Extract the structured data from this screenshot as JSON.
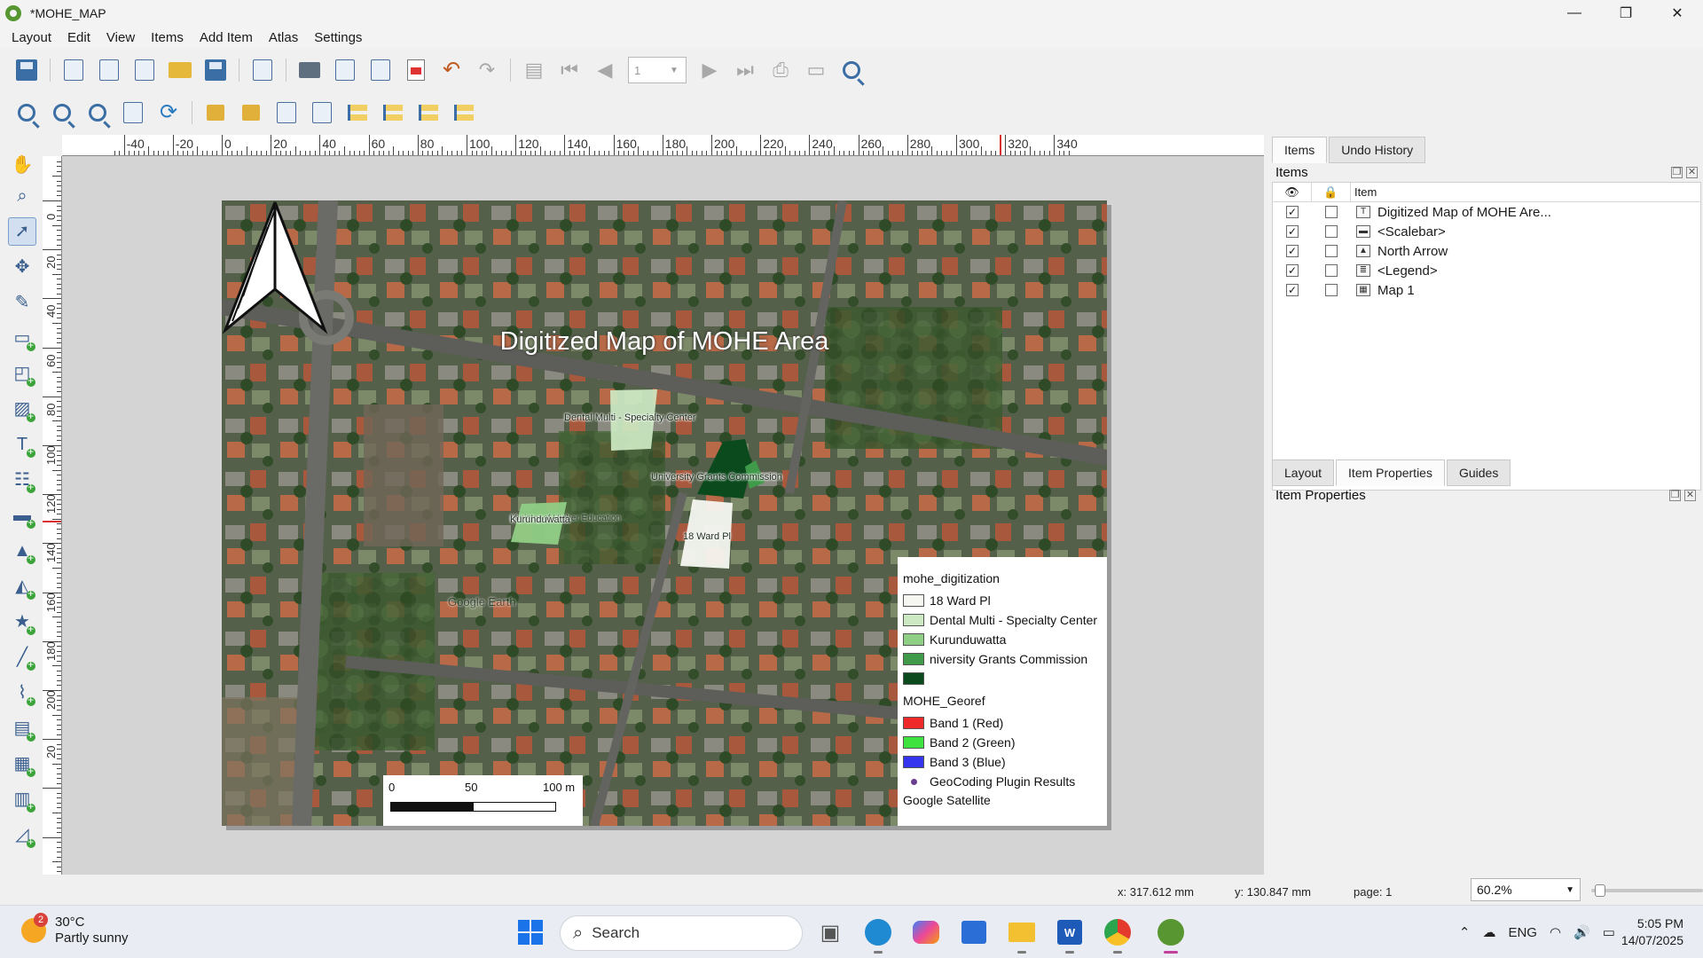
{
  "window": {
    "title": "*MOHE_MAP",
    "minimize": "—",
    "maximize": "❐",
    "close": "✕"
  },
  "menu": [
    "Layout",
    "Edit",
    "View",
    "Items",
    "Add Item",
    "Atlas",
    "Settings"
  ],
  "toolbar": {
    "page_value": "1"
  },
  "rulers": {
    "h_labels": [
      "-40",
      "-20",
      "0",
      "20",
      "40",
      "60",
      "80",
      "100",
      "120",
      "140",
      "160",
      "180",
      "200",
      "220",
      "240",
      "260",
      "280",
      "300",
      "320",
      "340"
    ],
    "v_labels": [
      "0",
      "20",
      "40",
      "60",
      "80",
      "100",
      "120",
      "140",
      "160",
      "180",
      "200",
      "20"
    ]
  },
  "layout": {
    "title": "Digitized Map of MOHE Area",
    "polygon_labels": {
      "dental": "Dental Multi - Specialty Center",
      "ugc": "University Grants Commission",
      "kurunduwatta": "Kurunduwatta",
      "ward": "18 Ward Pl",
      "ministry": "Ministry of Higher Education",
      "google": "Google Earth"
    },
    "scalebar": {
      "labels": [
        "0",
        "50",
        "100 m"
      ]
    },
    "legend": {
      "group1": "mohe_digitization",
      "group1_items": [
        {
          "label": "18 Ward Pl",
          "color": "#f6f7f1"
        },
        {
          "label": "Dental Multi - Specialty Center",
          "color": "#cde9c3"
        },
        {
          "label": "Kurunduwatta",
          "color": "#8fce85"
        },
        {
          "label": "niversity Grants Commission",
          "color": "#3f9a4a"
        },
        {
          "label": "",
          "color": "#0b4a1d"
        }
      ],
      "group2": "MOHE_Georef",
      "group2_items": [
        {
          "label": "Band 1 (Red)",
          "color": "#ef2929"
        },
        {
          "label": "Band 2 (Green)",
          "color": "#3fe33f"
        },
        {
          "label": "Band 3 (Blue)",
          "color": "#3535ef"
        }
      ],
      "geocoding": "GeoCoding Plugin Results",
      "basemap": "Google Satellite"
    }
  },
  "right_panel": {
    "top_tabs": [
      "Items",
      "Undo History"
    ],
    "items_title": "Items",
    "items_header": {
      "item": "Item"
    },
    "items": [
      {
        "label": "Digitized Map of MOHE Are...",
        "icon": "T",
        "visible": "✓"
      },
      {
        "label": "<Scalebar>",
        "icon": "▬",
        "visible": "✓"
      },
      {
        "label": "North Arrow",
        "icon": "▲",
        "visible": "✓"
      },
      {
        "label": "<Legend>",
        "icon": "≣",
        "visible": "✓"
      },
      {
        "label": "Map 1",
        "icon": "▦",
        "visible": "✓"
      }
    ],
    "bottom_tabs": [
      "Layout",
      "Item Properties",
      "Guides"
    ],
    "props_title": "Item Properties"
  },
  "status": {
    "x": "x: 317.612 mm",
    "y": "y: 130.847 mm",
    "page": "page: 1",
    "zoom": "60.2%"
  },
  "taskbar": {
    "weather_temp": "30°C",
    "weather_desc": "Partly sunny",
    "weather_badge": "2",
    "search_placeholder": "Search",
    "tray_lang": "ENG",
    "time": "5:05 PM",
    "date": "14/07/2025"
  },
  "colors": {
    "accent": "#589632",
    "ruler_cursor": "#d83030"
  }
}
